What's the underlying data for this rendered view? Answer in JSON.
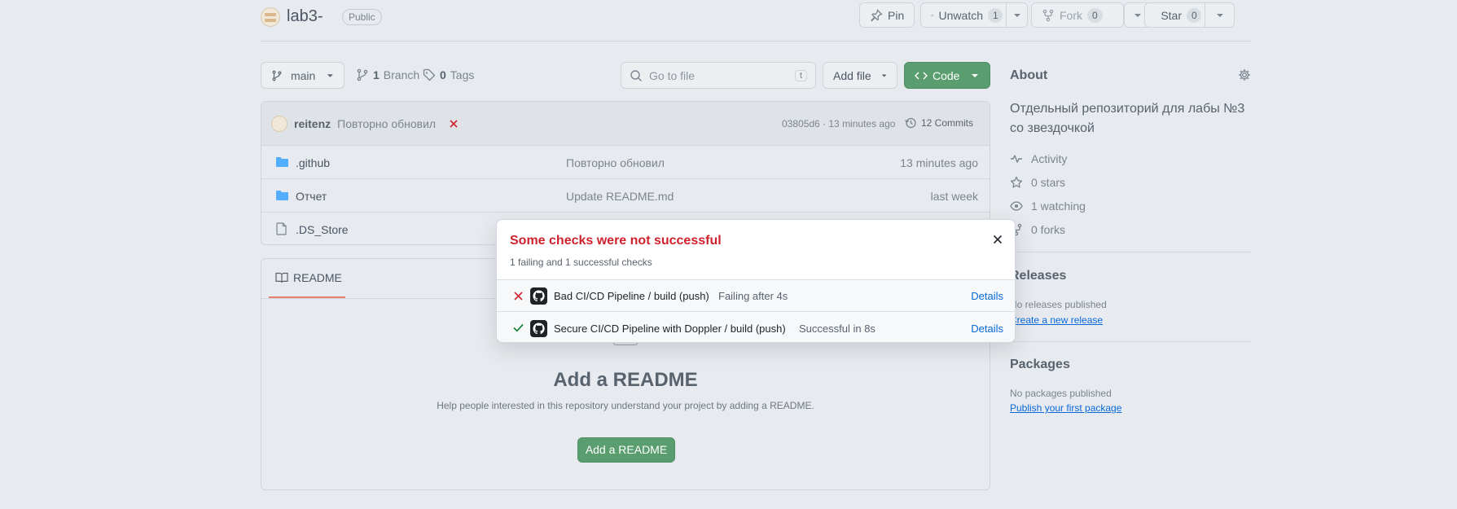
{
  "repo": {
    "name": "lab3-",
    "visibility": "Public"
  },
  "actions": {
    "pin": "Pin",
    "unwatch": "Unwatch",
    "watch_count": "1",
    "fork": "Fork",
    "fork_count": "0",
    "star": "Star",
    "star_count": "0"
  },
  "toolbar": {
    "branch": "main",
    "branch_count": "1",
    "branch_label": "Branch",
    "tag_count": "0",
    "tag_label": "Tags",
    "search_placeholder": "Go to file",
    "search_kbd": "t",
    "add_file": "Add file",
    "code": "Code"
  },
  "commit": {
    "author": "reitenz",
    "message": "Повторно обновил",
    "hash_time": "03805d6 · 13 minutes ago",
    "commits": "12 Commits"
  },
  "files": [
    {
      "name": ".github",
      "message": "Повторно обновил",
      "time": "13 minutes ago"
    },
    {
      "name": "Отчет",
      "message": "Update README.md",
      "time": "last week"
    },
    {
      "name": ".DS_Store",
      "message": "",
      "time": ""
    }
  ],
  "readme": {
    "tab": "README",
    "title": "Add a README",
    "desc": "Help people interested in this repository understand your project by adding a README.",
    "button": "Add a README"
  },
  "about": {
    "title": "About",
    "description": "Отдельный репозиторий для лабы №3 со звездочкой",
    "activity": "Activity",
    "stars": "0 stars",
    "watching": "1 watching",
    "forks": "0 forks"
  },
  "releases": {
    "title": "Releases",
    "none": "No releases published",
    "create": "Create a new release"
  },
  "packages": {
    "title": "Packages",
    "none": "No packages published",
    "publish": "Publish your first package"
  },
  "popup": {
    "title": "Some checks were not successful",
    "subtitle": "1 failing and 1 successful checks",
    "checks": [
      {
        "name": "Bad CI/CD Pipeline / build (push)",
        "status": "Failing after 4s",
        "details": "Details",
        "state": "fail"
      },
      {
        "name": "Secure CI/CD Pipeline with Doppler / build (push)",
        "status": "Successful in 8s",
        "details": "Details",
        "state": "success"
      }
    ]
  },
  "colors": {
    "danger": "#cf222e",
    "success": "#1a7f37",
    "link": "#0969da",
    "code_button": "#5a9e6f"
  }
}
